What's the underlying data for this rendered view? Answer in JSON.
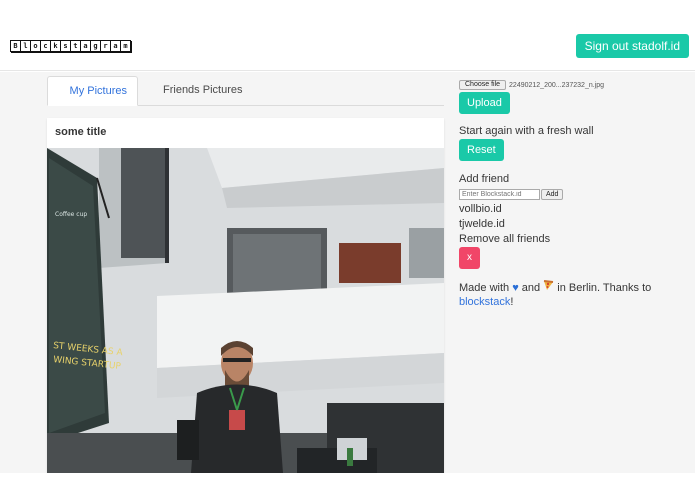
{
  "header": {
    "logo_letters": [
      "B",
      "l",
      "o",
      "c",
      "k",
      "s",
      "t",
      "a",
      "g",
      "r",
      "a",
      "m"
    ],
    "signout_label": "Sign out stadolf.id"
  },
  "tabs": [
    {
      "label": "My Pictures",
      "active": true
    },
    {
      "label": "Friends Pictures",
      "active": false
    }
  ],
  "post": {
    "title": "some title"
  },
  "upload": {
    "choose_file_label": "Choose file",
    "file_name": "22490212_200...237232_n.jpg",
    "upload_label": "Upload"
  },
  "reset": {
    "text": "Start again with a fresh wall",
    "button_label": "Reset"
  },
  "friends": {
    "heading": "Add friend",
    "input_placeholder": "Enter Blockstack.id",
    "add_label": "Add",
    "list": [
      "vollbio.id",
      "tjwelde.id"
    ],
    "remove_all_text": "Remove all friends",
    "remove_button_label": "x"
  },
  "footer": {
    "made_with": "Made with",
    "and": "and",
    "in_berlin": "in Berlin. Thanks to",
    "link_text": "blockstack",
    "end": "!"
  },
  "colors": {
    "accent": "#1ac9a8",
    "danger": "#f14668",
    "link": "#3273dc"
  }
}
